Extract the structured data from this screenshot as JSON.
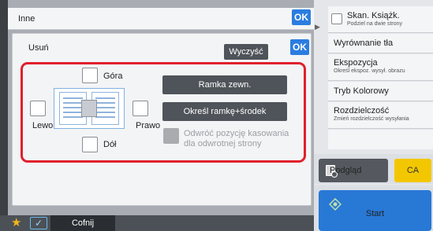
{
  "inne_panel": {
    "title": "Inne",
    "ok_label": "OK"
  },
  "dialog": {
    "title": "Usuń",
    "clear_label": "Wyczyść",
    "ok_label": "OK",
    "checkboxes": {
      "top": "Góra",
      "left": "Lewo",
      "right": "Prawo",
      "bottom": "Dół"
    },
    "buttons": {
      "outer_frame": "Ramka zewn.",
      "frame_center": "Określ ramkę+środek"
    },
    "reverse_option": {
      "line1": "Odwróć pozycję kasowania",
      "line2": "dla odwrotnej strony"
    }
  },
  "right_panel": {
    "items": [
      {
        "title": "Skan. Książk.",
        "subtitle": "Podziel na dwie strony"
      },
      {
        "title": "Wyrównanie tła",
        "subtitle": ""
      },
      {
        "title": "Ekspozycja",
        "subtitle": "Określ ekspoz. wysył. obrazu"
      },
      {
        "title": "Tryb Kolorowy",
        "subtitle": ""
      },
      {
        "title": "Rozdzielczość",
        "subtitle": "Zmień rozdzielczość wysyłania"
      }
    ],
    "preview_label": "Podgląd",
    "ca_label": "CA",
    "start_label": "Start"
  },
  "bottom_bar": {
    "back_label": "Cofnij"
  },
  "colors": {
    "accent_blue": "#2b7de0",
    "highlight_red": "#e0202c",
    "ca_yellow": "#f3c700",
    "start_blue": "#2878d6"
  }
}
